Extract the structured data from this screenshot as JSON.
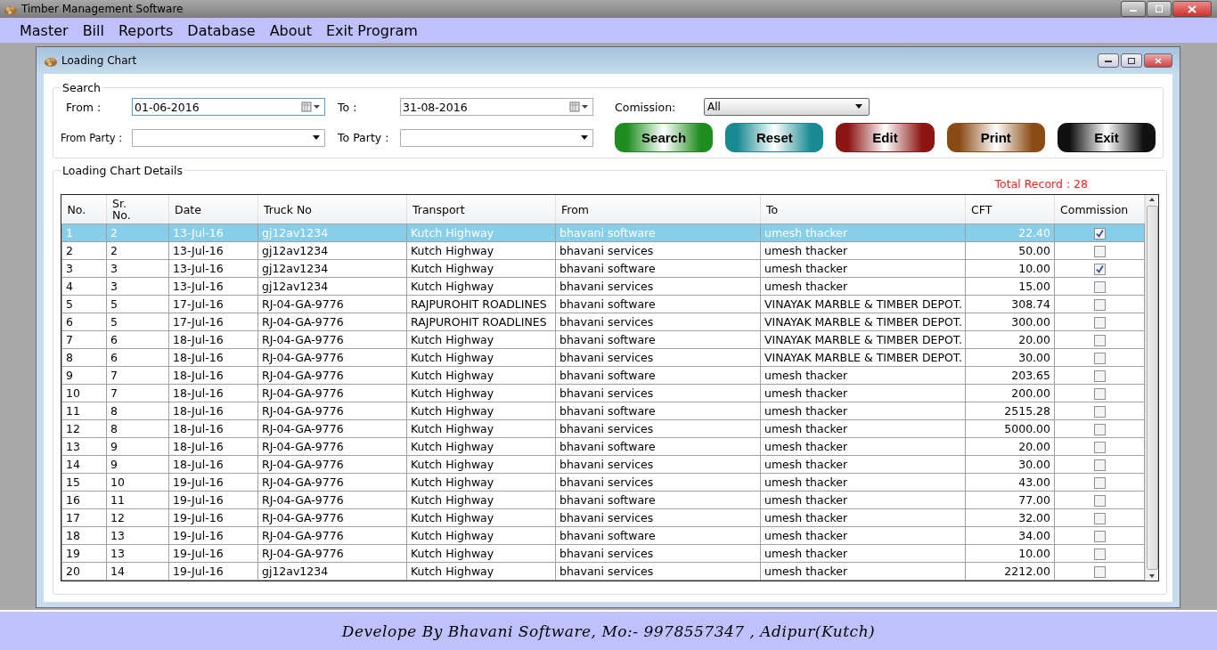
{
  "app_window": {
    "title": "Timber Management Software"
  },
  "menu": [
    "Master",
    "Bill",
    "Reports",
    "Database",
    "About",
    "Exit Program"
  ],
  "child_window": {
    "title": "Loading Chart"
  },
  "search": {
    "legend": "Search",
    "from_label": "From :",
    "from_value": "01-06-2016",
    "to_label": "To :",
    "to_value": "31-08-2016",
    "from_party_label": "From Party :",
    "to_party_label": "To Party :",
    "commission_label": "Comission:",
    "commission_value": "All"
  },
  "buttons": [
    {
      "label": "Search",
      "color": "#1e8c1e"
    },
    {
      "label": "Reset",
      "color": "#1a8a92"
    },
    {
      "label": "Edit",
      "color": "#8c1414"
    },
    {
      "label": "Print",
      "color": "#8a4a14"
    },
    {
      "label": "Exit",
      "color": "#111111"
    }
  ],
  "details": {
    "legend": "Loading Chart Details",
    "total_record": "Total Record : 28"
  },
  "table": {
    "columns": [
      "No.",
      "Sr.\nNo.",
      "Date",
      "Truck No",
      "Transport",
      "From",
      "To",
      "CFT",
      "Commission"
    ],
    "rows": [
      {
        "cells": [
          "1",
          "2",
          "13-Jul-16",
          "gj12av1234",
          "Kutch Highway",
          "bhavani software",
          "umesh thacker",
          "22.40"
        ],
        "commission": true,
        "selected": true
      },
      {
        "cells": [
          "2",
          "2",
          "13-Jul-16",
          "gj12av1234",
          "Kutch Highway",
          "bhavani services",
          "umesh thacker",
          "50.00"
        ],
        "commission": false,
        "selected": false
      },
      {
        "cells": [
          "3",
          "3",
          "13-Jul-16",
          "gj12av1234",
          "Kutch Highway",
          "bhavani software",
          "umesh thacker",
          "10.00"
        ],
        "commission": true,
        "selected": false
      },
      {
        "cells": [
          "4",
          "3",
          "13-Jul-16",
          "gj12av1234",
          "Kutch Highway",
          "bhavani services",
          "umesh thacker",
          "15.00"
        ],
        "commission": false,
        "selected": false
      },
      {
        "cells": [
          "5",
          "5",
          "17-Jul-16",
          "RJ-04-GA-9776",
          "RAJPUROHIT ROADLINES",
          "bhavani software",
          "VINAYAK MARBLE & TIMBER DEPOT.",
          "308.74"
        ],
        "commission": false,
        "selected": false
      },
      {
        "cells": [
          "6",
          "5",
          "17-Jul-16",
          "RJ-04-GA-9776",
          "RAJPUROHIT ROADLINES",
          "bhavani services",
          "VINAYAK MARBLE & TIMBER DEPOT.",
          "300.00"
        ],
        "commission": false,
        "selected": false
      },
      {
        "cells": [
          "7",
          "6",
          "18-Jul-16",
          "RJ-04-GA-9776",
          "Kutch Highway",
          "bhavani software",
          "VINAYAK MARBLE & TIMBER DEPOT.",
          "20.00"
        ],
        "commission": false,
        "selected": false
      },
      {
        "cells": [
          "8",
          "6",
          "18-Jul-16",
          "RJ-04-GA-9776",
          "Kutch Highway",
          "bhavani services",
          "VINAYAK MARBLE & TIMBER DEPOT.",
          "30.00"
        ],
        "commission": false,
        "selected": false
      },
      {
        "cells": [
          "9",
          "7",
          "18-Jul-16",
          "RJ-04-GA-9776",
          "Kutch Highway",
          "bhavani software",
          "umesh thacker",
          "203.65"
        ],
        "commission": false,
        "selected": false
      },
      {
        "cells": [
          "10",
          "7",
          "18-Jul-16",
          "RJ-04-GA-9776",
          "Kutch Highway",
          "bhavani services",
          "umesh thacker",
          "200.00"
        ],
        "commission": false,
        "selected": false
      },
      {
        "cells": [
          "11",
          "8",
          "18-Jul-16",
          "RJ-04-GA-9776",
          "Kutch Highway",
          "bhavani software",
          "umesh thacker",
          "2515.28"
        ],
        "commission": false,
        "selected": false
      },
      {
        "cells": [
          "12",
          "8",
          "18-Jul-16",
          "RJ-04-GA-9776",
          "Kutch Highway",
          "bhavani services",
          "umesh thacker",
          "5000.00"
        ],
        "commission": false,
        "selected": false
      },
      {
        "cells": [
          "13",
          "9",
          "18-Jul-16",
          "RJ-04-GA-9776",
          "Kutch Highway",
          "bhavani software",
          "umesh thacker",
          "20.00"
        ],
        "commission": false,
        "selected": false
      },
      {
        "cells": [
          "14",
          "9",
          "18-Jul-16",
          "RJ-04-GA-9776",
          "Kutch Highway",
          "bhavani services",
          "umesh thacker",
          "30.00"
        ],
        "commission": false,
        "selected": false
      },
      {
        "cells": [
          "15",
          "10",
          "19-Jul-16",
          "RJ-04-GA-9776",
          "Kutch Highway",
          "bhavani services",
          "umesh thacker",
          "43.00"
        ],
        "commission": false,
        "selected": false
      },
      {
        "cells": [
          "16",
          "11",
          "19-Jul-16",
          "RJ-04-GA-9776",
          "Kutch Highway",
          "bhavani software",
          "umesh thacker",
          "77.00"
        ],
        "commission": false,
        "selected": false
      },
      {
        "cells": [
          "17",
          "12",
          "19-Jul-16",
          "RJ-04-GA-9776",
          "Kutch Highway",
          "bhavani services",
          "umesh thacker",
          "32.00"
        ],
        "commission": false,
        "selected": false
      },
      {
        "cells": [
          "18",
          "13",
          "19-Jul-16",
          "RJ-04-GA-9776",
          "Kutch Highway",
          "bhavani software",
          "umesh thacker",
          "34.00"
        ],
        "commission": false,
        "selected": false
      },
      {
        "cells": [
          "19",
          "13",
          "19-Jul-16",
          "RJ-04-GA-9776",
          "Kutch Highway",
          "bhavani services",
          "umesh thacker",
          "10.00"
        ],
        "commission": false,
        "selected": false
      },
      {
        "cells": [
          "20",
          "14",
          "19-Jul-16",
          "gj12av1234",
          "Kutch Highway",
          "bhavani services",
          "umesh thacker",
          "2212.00"
        ],
        "commission": false,
        "selected": false
      }
    ]
  },
  "footer": "Develope By Bhavani Software, Mo:- 9978557347 , Adipur(Kutch)"
}
